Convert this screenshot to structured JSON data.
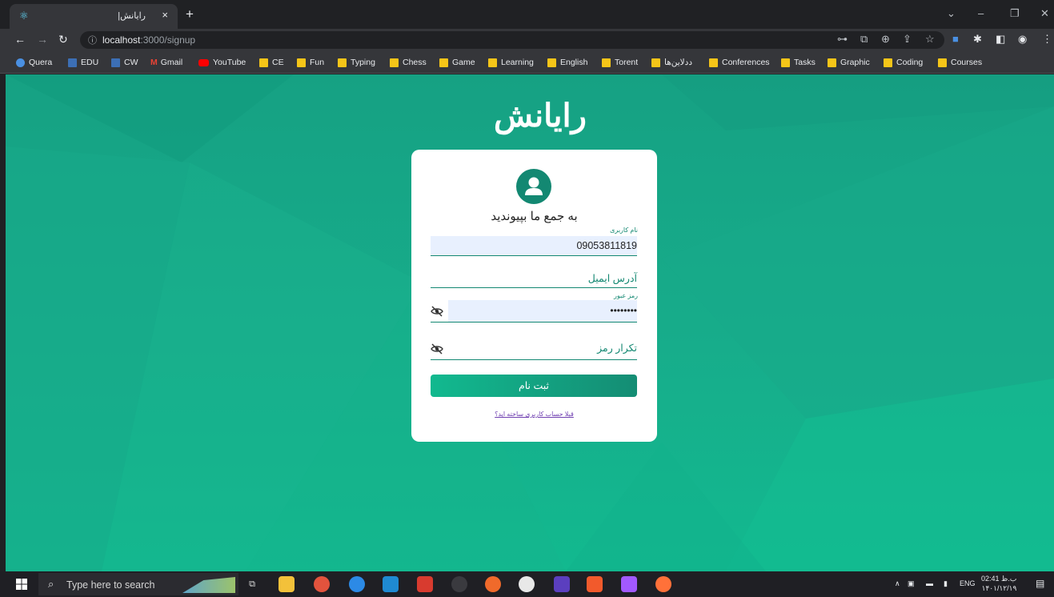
{
  "browser": {
    "tab_title": "رایانش|",
    "new_tab": "+",
    "tab_close": "×",
    "url_host": "localhost",
    "url_path": ":3000/signup"
  },
  "bookmarks": [
    {
      "label": "Quera",
      "icon": "quera-icon",
      "color": "#4a90e2"
    },
    {
      "label": "EDU",
      "icon": "edu-icon",
      "color": "#3c6fb5"
    },
    {
      "label": "CW",
      "icon": "cw-icon",
      "color": "#3c6fb5"
    },
    {
      "label": "Gmail",
      "icon": "gmail-icon",
      "color": "#ea4335"
    },
    {
      "label": "YouTube",
      "icon": "youtube-icon",
      "color": "#ff0000"
    },
    {
      "label": "CE",
      "icon": "folder-icon"
    },
    {
      "label": "Fun",
      "icon": "folder-icon"
    },
    {
      "label": "Typing",
      "icon": "folder-icon"
    },
    {
      "label": "Chess",
      "icon": "folder-icon"
    },
    {
      "label": "Game",
      "icon": "folder-icon"
    },
    {
      "label": "Learning",
      "icon": "folder-icon"
    },
    {
      "label": "English",
      "icon": "folder-icon"
    },
    {
      "label": "Torent",
      "icon": "folder-icon"
    },
    {
      "label": "ددلاین‌ها",
      "icon": "folder-icon"
    },
    {
      "label": "Conferences",
      "icon": "folder-icon"
    },
    {
      "label": "Tasks",
      "icon": "folder-icon"
    },
    {
      "label": "Graphic",
      "icon": "folder-icon"
    },
    {
      "label": "Coding",
      "icon": "folder-icon"
    },
    {
      "label": "Courses",
      "icon": "folder-icon"
    }
  ],
  "page": {
    "logo_text": "رایانش",
    "welcome": "به جمع ما بپیوندید",
    "username_label": "نام کاربری",
    "username_value": "09053811819",
    "email_placeholder": "آدرس ایمیل",
    "password_label": "رمز عبور",
    "password_value": "••••••••",
    "confirm_placeholder": "تکرار رمز",
    "submit_label": "ثبت نام",
    "login_link": "قبلا حساب کاربری ساخته اید؟"
  },
  "taskbar": {
    "search_placeholder": "Type here to search",
    "language": "ENG",
    "time": "02:41 ب.ظ",
    "date": "۱۴۰۱/۱۲/۱۹"
  },
  "colors": {
    "accent": "#138872",
    "background_gradient_top": "#16a183",
    "background_gradient_bottom": "#12b98f",
    "link": "#6f3fb1"
  }
}
